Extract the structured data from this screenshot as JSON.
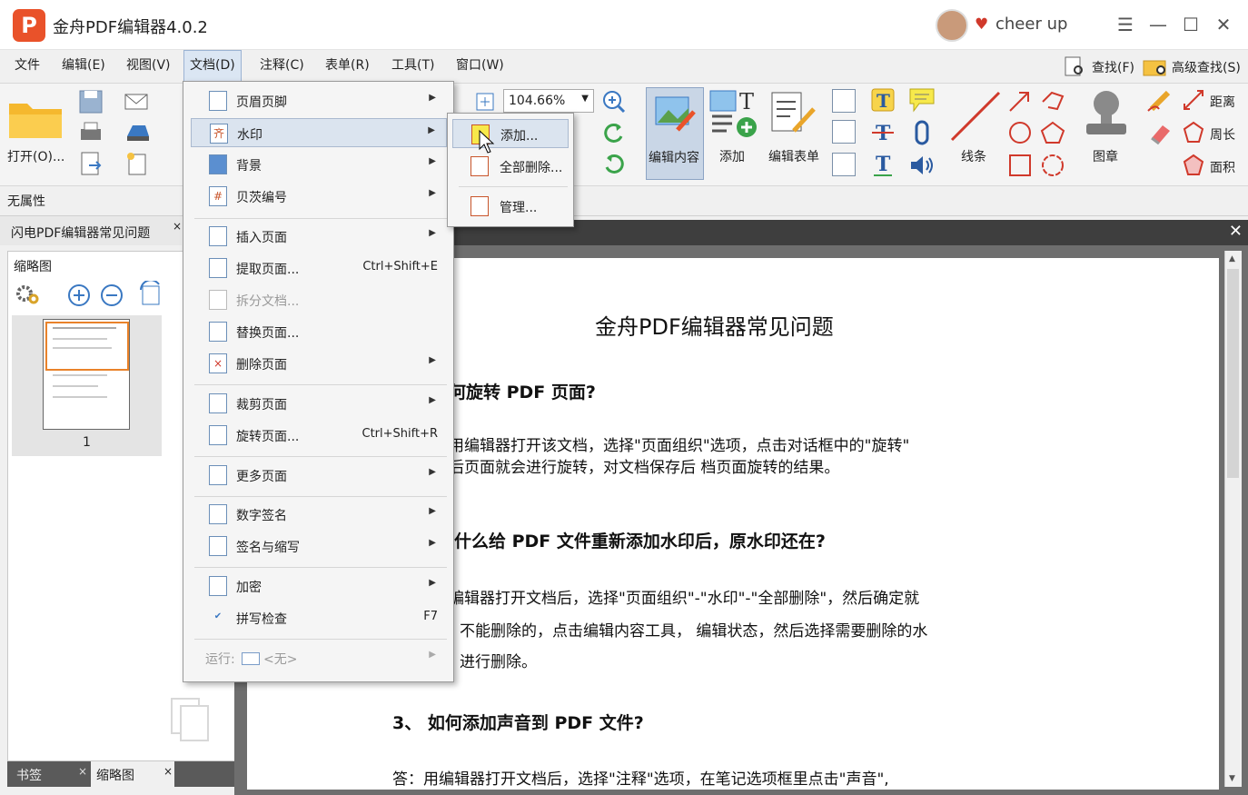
{
  "app": {
    "title": "金舟PDF编辑器4.0.2",
    "logo_letter": "P",
    "user_name": "cheer up"
  },
  "window_controls": {
    "menu": "☰",
    "minimize": "—",
    "maximize": "☐",
    "close": "✕"
  },
  "menubar": [
    "文件",
    "编辑(E)",
    "视图(V)",
    "文档(D)",
    "注释(C)",
    "表单(R)",
    "工具(T)",
    "窗口(W)"
  ],
  "search": {
    "find": "查找(F)",
    "advanced": "高级查找(S)"
  },
  "toolbar": {
    "open": "打开(O)...",
    "zoom": "104.66%",
    "edit_content": "编辑内容",
    "add": "添加",
    "edit_form": "编辑表单",
    "line": "线条",
    "stamp": "图章",
    "distance": "距离",
    "perimeter": "周长",
    "area": "面积"
  },
  "properties_bar": "无属性",
  "document_tab": "闪电PDF编辑器常见问题",
  "thumbnail_panel": {
    "title": "缩略图",
    "page_number": "1"
  },
  "bottom_tabs": [
    "书签",
    "缩略图"
  ],
  "document_menu": {
    "items": [
      {
        "label": "页眉页脚",
        "shortcut": ""
      },
      {
        "label": "水印",
        "shortcut": ""
      },
      {
        "label": "背景",
        "shortcut": ""
      },
      {
        "label": "贝茨编号",
        "shortcut": ""
      },
      {
        "label": "插入页面",
        "shortcut": ""
      },
      {
        "label": "提取页面...",
        "shortcut": "Ctrl+Shift+E"
      },
      {
        "label": "拆分文档...",
        "shortcut": ""
      },
      {
        "label": "替换页面...",
        "shortcut": ""
      },
      {
        "label": "删除页面",
        "shortcut": ""
      },
      {
        "label": "裁剪页面",
        "shortcut": ""
      },
      {
        "label": "旋转页面...",
        "shortcut": "Ctrl+Shift+R"
      },
      {
        "label": "更多页面",
        "shortcut": ""
      },
      {
        "label": "数字签名",
        "shortcut": ""
      },
      {
        "label": "签名与缩写",
        "shortcut": ""
      },
      {
        "label": "加密",
        "shortcut": ""
      },
      {
        "label": "拼写检查",
        "shortcut": "F7"
      },
      {
        "label": "运行:",
        "shortcut": ""
      }
    ],
    "run_value": "<无>"
  },
  "watermark_submenu": [
    "添加...",
    "全部删除...",
    "管理..."
  ],
  "document": {
    "title": "金舟PDF编辑器常见问题",
    "q1": "何旋转 PDF 页面?",
    "a1_l1": "用编辑器打开该文档，选择\"页面组织\"选项，点击对话框中的\"旋转\"",
    "a1_l2": "后页面就会进行旋转，对文档保存后 档页面旋转的结果。",
    "q2": "什么给 PDF 文件重新添加水印后，原水印还在?",
    "a2_l1": "编辑器打开文档后，选择\"页面组织\"-\"水印\"-\"全部删除\"，然后确定就",
    "a2_l2": "不能删除的，点击编辑内容工具， 编辑状态，然后选择需要删除的水",
    "a2_l3": "进行删除。",
    "q3": "3、 如何添加声音到 PDF 文件?",
    "a3_l1": "答：用编辑器打开文档后，选择\"注释\"选项，在笔记选项框里点击\"声音\","
  },
  "colors": {
    "accent": "#e9522a",
    "menu_highlight": "#dbe4ef",
    "doc_bg": "#6e6e6e"
  }
}
